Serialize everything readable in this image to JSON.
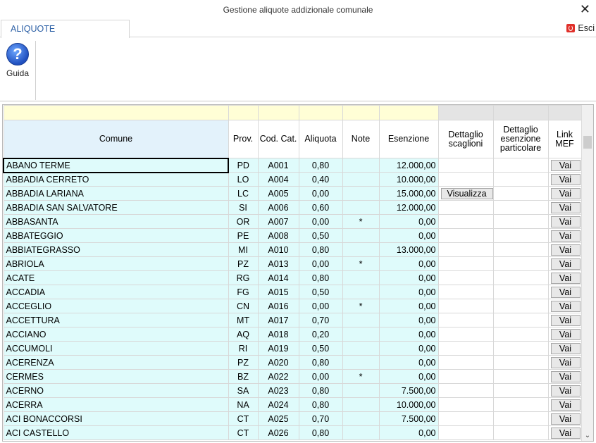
{
  "window": {
    "title": "Gestione aliquote addizionale comunale",
    "close_glyph": "✕"
  },
  "tabs": {
    "active_label": "ALIQUOTE"
  },
  "exit": {
    "label": "Esci"
  },
  "ribbon": {
    "help_label": "Guida",
    "help_glyph": "?"
  },
  "grid": {
    "columns": {
      "comune": "Comune",
      "prov": "Prov.",
      "cod_cat": "Cod. Cat.",
      "aliquota": "Aliquota",
      "note": "Note",
      "esenzione": "Esenzione",
      "dettaglio_scaglioni": "Dettaglio scaglioni",
      "dettaglio_esenzione": "Dettaglio esenzione particolare",
      "link_mef": "Link MEF"
    },
    "button_vai": "Vai",
    "button_visualizza": "Visualizza",
    "rows": [
      {
        "comune": "ABANO TERME",
        "prov": "PD",
        "cod": "A001",
        "aliquota": "0,80",
        "note": "",
        "esenzione": "12.000,00",
        "scaglioni": false
      },
      {
        "comune": "ABBADIA CERRETO",
        "prov": "LO",
        "cod": "A004",
        "aliquota": "0,40",
        "note": "",
        "esenzione": "10.000,00",
        "scaglioni": false
      },
      {
        "comune": "ABBADIA LARIANA",
        "prov": "LC",
        "cod": "A005",
        "aliquota": "0,00",
        "note": "",
        "esenzione": "15.000,00",
        "scaglioni": true
      },
      {
        "comune": "ABBADIA SAN SALVATORE",
        "prov": "SI",
        "cod": "A006",
        "aliquota": "0,60",
        "note": "",
        "esenzione": "12.000,00",
        "scaglioni": false
      },
      {
        "comune": "ABBASANTA",
        "prov": "OR",
        "cod": "A007",
        "aliquota": "0,00",
        "note": "*",
        "esenzione": "0,00",
        "scaglioni": false
      },
      {
        "comune": "ABBATEGGIO",
        "prov": "PE",
        "cod": "A008",
        "aliquota": "0,50",
        "note": "",
        "esenzione": "0,00",
        "scaglioni": false
      },
      {
        "comune": "ABBIATEGRASSO",
        "prov": "MI",
        "cod": "A010",
        "aliquota": "0,80",
        "note": "",
        "esenzione": "13.000,00",
        "scaglioni": false
      },
      {
        "comune": "ABRIOLA",
        "prov": "PZ",
        "cod": "A013",
        "aliquota": "0,00",
        "note": "*",
        "esenzione": "0,00",
        "scaglioni": false
      },
      {
        "comune": "ACATE",
        "prov": "RG",
        "cod": "A014",
        "aliquota": "0,80",
        "note": "",
        "esenzione": "0,00",
        "scaglioni": false
      },
      {
        "comune": "ACCADIA",
        "prov": "FG",
        "cod": "A015",
        "aliquota": "0,50",
        "note": "",
        "esenzione": "0,00",
        "scaglioni": false
      },
      {
        "comune": "ACCEGLIO",
        "prov": "CN",
        "cod": "A016",
        "aliquota": "0,00",
        "note": "*",
        "esenzione": "0,00",
        "scaglioni": false
      },
      {
        "comune": "ACCETTURA",
        "prov": "MT",
        "cod": "A017",
        "aliquota": "0,70",
        "note": "",
        "esenzione": "0,00",
        "scaglioni": false
      },
      {
        "comune": "ACCIANO",
        "prov": "AQ",
        "cod": "A018",
        "aliquota": "0,20",
        "note": "",
        "esenzione": "0,00",
        "scaglioni": false
      },
      {
        "comune": "ACCUMOLI",
        "prov": "RI",
        "cod": "A019",
        "aliquota": "0,50",
        "note": "",
        "esenzione": "0,00",
        "scaglioni": false
      },
      {
        "comune": "ACERENZA",
        "prov": "PZ",
        "cod": "A020",
        "aliquota": "0,80",
        "note": "",
        "esenzione": "0,00",
        "scaglioni": false
      },
      {
        "comune": "CERMES",
        "prov": "BZ",
        "cod": "A022",
        "aliquota": "0,00",
        "note": "*",
        "esenzione": "0,00",
        "scaglioni": false
      },
      {
        "comune": "ACERNO",
        "prov": "SA",
        "cod": "A023",
        "aliquota": "0,80",
        "note": "",
        "esenzione": "7.500,00",
        "scaglioni": false
      },
      {
        "comune": "ACERRA",
        "prov": "NA",
        "cod": "A024",
        "aliquota": "0,80",
        "note": "",
        "esenzione": "10.000,00",
        "scaglioni": false
      },
      {
        "comune": "ACI BONACCORSI",
        "prov": "CT",
        "cod": "A025",
        "aliquota": "0,70",
        "note": "",
        "esenzione": "7.500,00",
        "scaglioni": false
      },
      {
        "comune": "ACI CASTELLO",
        "prov": "CT",
        "cod": "A026",
        "aliquota": "0,80",
        "note": "",
        "esenzione": "0,00",
        "scaglioni": false
      }
    ]
  }
}
